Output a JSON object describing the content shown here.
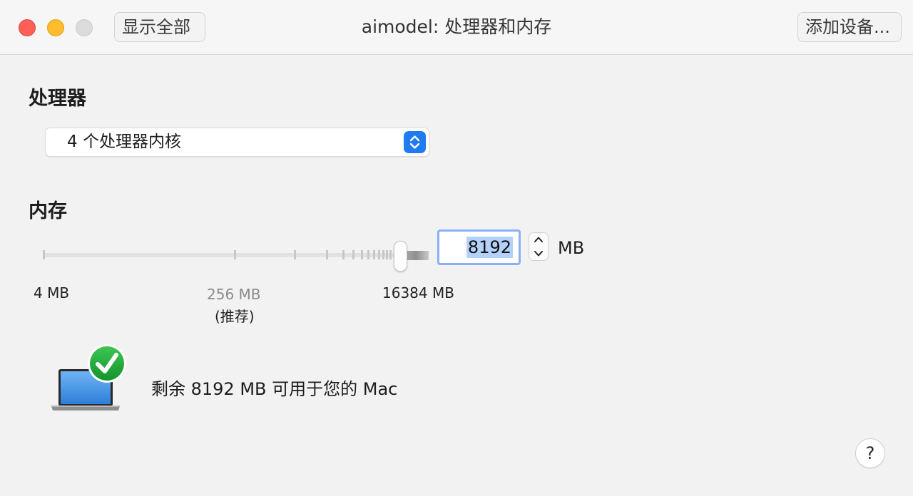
{
  "window": {
    "title": "aimodel: 处理器和内存",
    "show_all_label": "显示全部",
    "add_device_label": "添加设备..."
  },
  "processor": {
    "section_title": "处理器",
    "selected": "4 个处理器内核"
  },
  "memory": {
    "section_title": "内存",
    "value": "8192",
    "unit": "MB",
    "slider_value_mb": 8192,
    "scale": {
      "min_label": "4 MB",
      "recommended_label": "256 MB",
      "recommended_note": "(推荐)",
      "max_label": "16384 MB"
    }
  },
  "status": {
    "text": "剩余 8192 MB 可用于您的 Mac",
    "icon": "laptop-checkmark-icon"
  },
  "help": {
    "label": "?"
  },
  "colors": {
    "accent": "#1f7cf0",
    "check_green": "#22a83b",
    "close": "#fe5f57",
    "minimize": "#febc2e",
    "zoom_disabled": "#dcdcdc",
    "selection": "#b3d1fb",
    "focus_ring": "#8bb0f4"
  }
}
